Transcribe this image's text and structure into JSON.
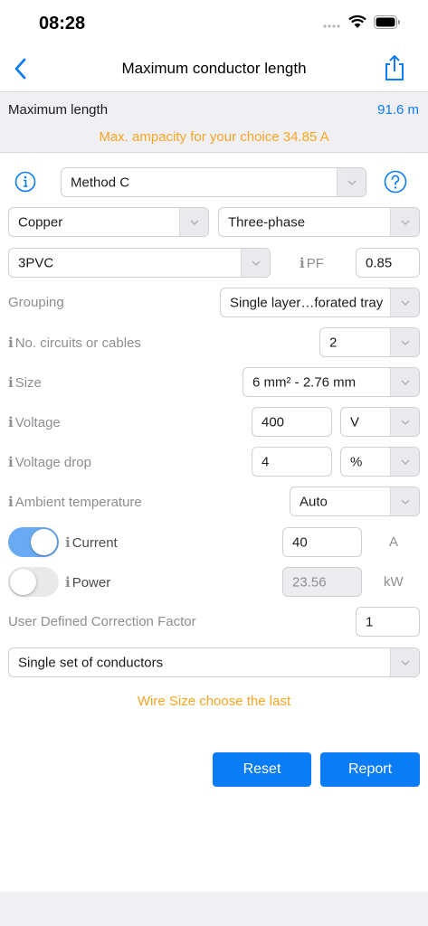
{
  "status": {
    "time": "08:28"
  },
  "nav": {
    "title": "Maximum conductor length",
    "back_icon": "chevron-left-icon",
    "share_icon": "share-icon"
  },
  "summary": {
    "label": "Maximum length",
    "value": "91.6 m",
    "warning": "Max. ampacity for your choice 34.85 A"
  },
  "method": {
    "selected": "Method C"
  },
  "material": {
    "selected": "Copper"
  },
  "phase": {
    "selected": "Three-phase"
  },
  "insulation": {
    "selected": "3PVC"
  },
  "pf": {
    "label": "PF",
    "value": "0.85"
  },
  "grouping": {
    "label": "Grouping",
    "selected": "Single layer…forated tray"
  },
  "circuits": {
    "label": "No. circuits or cables",
    "selected": "2"
  },
  "size": {
    "label": "Size",
    "selected": "6 mm² - 2.76 mm"
  },
  "voltage": {
    "label": "Voltage",
    "value": "400",
    "unit": "V"
  },
  "voltage_drop": {
    "label": "Voltage drop",
    "value": "4",
    "unit": "%"
  },
  "ambient": {
    "label": "Ambient temperature",
    "selected": "Auto"
  },
  "current": {
    "label": "Current",
    "value": "40",
    "unit": "A",
    "enabled": true
  },
  "power": {
    "label": "Power",
    "value": "23.56",
    "unit": "kW",
    "enabled": false
  },
  "correction": {
    "label": "User Defined Correction Factor",
    "value": "1"
  },
  "conductor_set": {
    "selected": "Single set of conductors"
  },
  "hint": "Wire Size choose the last",
  "buttons": {
    "reset": "Reset",
    "report": "Report"
  },
  "colors": {
    "accent": "#0a7cf5",
    "warning": "#f5a623",
    "toggle_on": "#6aaaf5"
  }
}
